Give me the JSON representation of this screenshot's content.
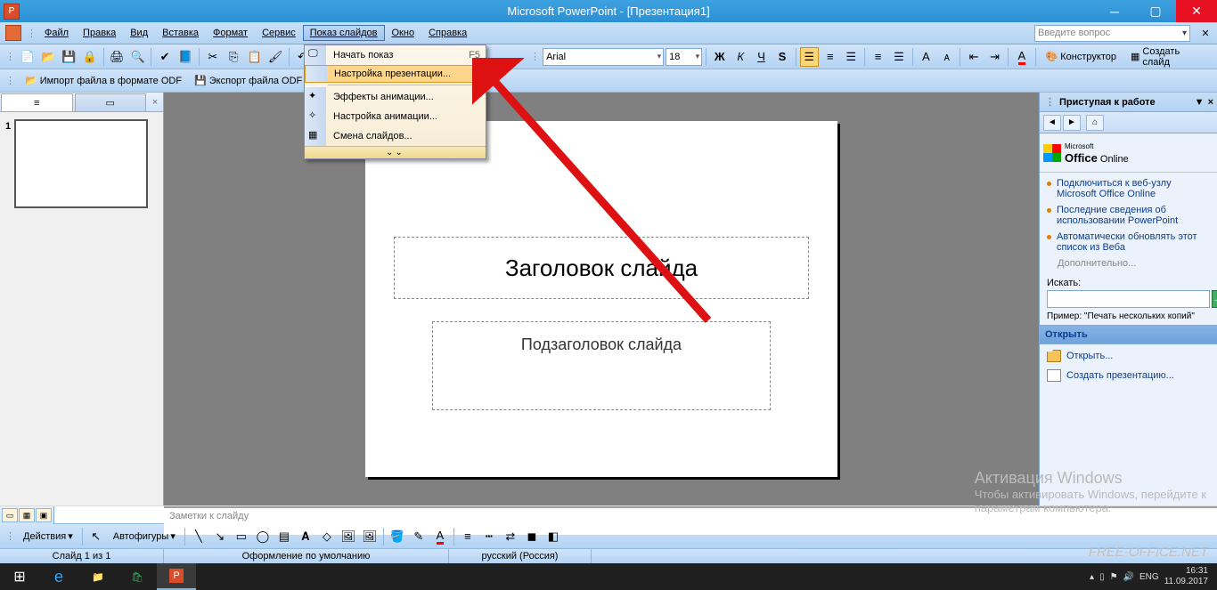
{
  "title": "Microsoft PowerPoint - [Презентация1]",
  "menubar": {
    "file": "Файл",
    "edit": "Правка",
    "view": "Вид",
    "insert": "Вставка",
    "format": "Формат",
    "tools": "Сервис",
    "slideshow": "Показ слайдов",
    "window": "Окно",
    "help": "Справка",
    "ask_placeholder": "Введите вопрос"
  },
  "toolbar2": {
    "import_odf": "Импорт файла в формате ODF",
    "export_odf": "Экспорт файла ODF"
  },
  "format_toolbar": {
    "font": "Arial",
    "size": "18",
    "designer": "Конструктор",
    "new_slide": "Создать слайд"
  },
  "dropdown": {
    "start_show": "Начать показ",
    "start_show_key": "F5",
    "setup_show": "Настройка презентации...",
    "anim_effects": "Эффекты анимации...",
    "anim_setup": "Настройка анимации...",
    "slide_transition": "Смена слайдов..."
  },
  "slide": {
    "title_placeholder": "Заголовок слайда",
    "subtitle_placeholder": "Подзаголовок слайда"
  },
  "thumbs": {
    "num1": "1"
  },
  "notes": {
    "placeholder": "Заметки к слайду"
  },
  "task_pane": {
    "header": "Приступая к работе",
    "brand_a": "Office",
    "brand_b": "Online",
    "brand_pre": "Microsoft",
    "link1": "Подключиться к веб-узлу Microsoft Office Online",
    "link2": "Последние сведения об использовании PowerPoint",
    "link3": "Автоматически обновлять этот список из Веба",
    "more": "Дополнительно...",
    "search_label": "Искать:",
    "example_label": "Пример:",
    "example_text": "\"Печать нескольких копий\"",
    "open_header": "Открыть",
    "open_item": "Открыть...",
    "create_item": "Создать презентацию..."
  },
  "drawing": {
    "actions": "Действия",
    "autoshapes": "Автофигуры"
  },
  "status": {
    "slide_pos": "Слайд 1 из 1",
    "theme": "Оформление по умолчанию",
    "lang": "русский (Россия)"
  },
  "watermark": {
    "t": "Активация Windows",
    "l1": "Чтобы активировать Windows, перейдите к",
    "l2": "параметрам компьютера."
  },
  "watermark2": "FREE-OFFICE.NET",
  "taskbar": {
    "lang": "ENG",
    "time": "16:31",
    "date": "11.09.2017"
  }
}
